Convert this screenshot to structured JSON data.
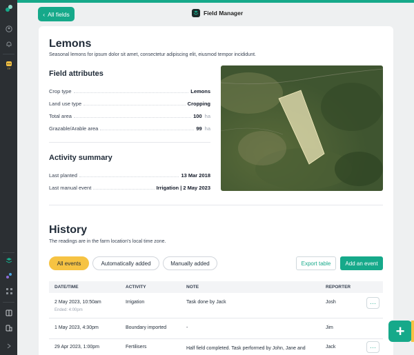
{
  "header": {
    "back_label": "All fields",
    "app_title": "Field Manager"
  },
  "rail": {
    "avatar_badge": "TF"
  },
  "field": {
    "name": "Lemons",
    "description": "Seasonal lemons for ipsum dolor sit amet, consectetur adipiscing elit, eiusmod tempor incididunt."
  },
  "attributes": {
    "title": "Field attributes",
    "rows": [
      {
        "label": "Crop type",
        "value": "Lemons",
        "unit": ""
      },
      {
        "label": "Land use type",
        "value": "Cropping",
        "unit": ""
      },
      {
        "label": "Total area",
        "value": "100",
        "unit": "ha"
      },
      {
        "label": "Grazable/Arable area",
        "value": "99",
        "unit": "ha"
      }
    ]
  },
  "activity": {
    "title": "Activity summary",
    "rows": [
      {
        "label": "Last planted",
        "value": "13 Mar 2018"
      },
      {
        "label": "Last manual event",
        "value": "Irrigation | 2 May 2023"
      }
    ]
  },
  "history": {
    "title": "History",
    "subtitle": "The readings are in the farm location's local time zone.",
    "filters": [
      "All events",
      "Automatically added",
      "Manually added"
    ],
    "export_label": "Export table",
    "add_label": "Add an event",
    "columns": [
      "DATE/TIME",
      "ACTIVITY",
      "NOTE",
      "REPORTER"
    ],
    "rows": [
      {
        "date": "2 May 2023, 10:50am",
        "sub": "Ended: 4:00pm",
        "activity": "Irrigation",
        "note": "Task done by Jack",
        "reporter": "Josh",
        "more": "···"
      },
      {
        "date": "1 May 2023, 4:30pm",
        "sub": "",
        "activity": "Boundary imported",
        "note": "-",
        "reporter": "Jim",
        "more": ""
      },
      {
        "date": "29 Apr 2023, 1:00pm",
        "sub": "",
        "activity": "Fertilisers",
        "note": "Half field completed. Task performed by John, Jane and",
        "reporter": "Jack",
        "more": "···"
      }
    ]
  },
  "fab_label": "+",
  "colors": {
    "accent": "#16a98a",
    "highlight": "#f6c343",
    "rail": "#2b2f33"
  }
}
